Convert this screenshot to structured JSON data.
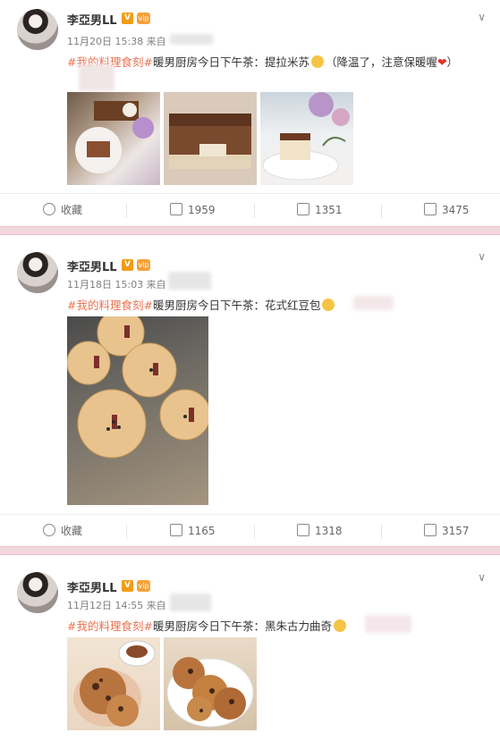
{
  "posts": [
    {
      "user": "李亞男LL",
      "time": "11月20日 15:38 来自",
      "text_topic": "#我的料理食刻#",
      "text_main": "暖男厨房今日下午茶：提拉米苏",
      "text_tail": "（降温了，注意保暖喔",
      "text_end": "）",
      "actions": {
        "fav": "收藏",
        "share": "1959",
        "comment": "1351",
        "like": "3475"
      },
      "images": [
        "tiramisu-slice-with-flowers",
        "tiramisu-tray",
        "tiramisu-plate-with-flowers"
      ]
    },
    {
      "user": "李亞男LL",
      "time": "11月18日 15:03 来自",
      "text_topic": "#我的料理食刻#",
      "text_main": "暖男厨房今日下午茶：花式红豆包",
      "actions": {
        "fav": "收藏",
        "share": "1165",
        "comment": "1318",
        "like": "3157"
      },
      "images": [
        "flower-red-bean-buns"
      ]
    },
    {
      "user": "李亞男LL",
      "time": "11月12日 14:55 来自",
      "text_topic": "#我的料理食刻#",
      "text_main": "暖男厨房今日下午茶：黑朱古力曲奇",
      "images": [
        "chocolate-cookie-in-hand",
        "chocolate-cookies-on-plate"
      ]
    }
  ],
  "badges": {
    "verified": "V",
    "vip": "vip"
  },
  "colors": {
    "topic": "#eb7350",
    "divider": "#f2d7dd",
    "meta": "#808080"
  },
  "icons": [
    "star-icon",
    "share-icon",
    "comment-icon",
    "like-icon",
    "chevron-down-icon",
    "emoji-icon",
    "heart-icon"
  ]
}
